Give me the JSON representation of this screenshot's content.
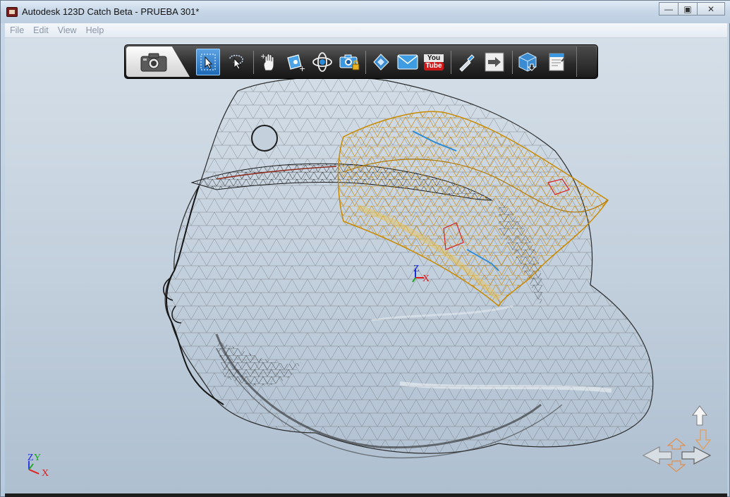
{
  "window": {
    "title": "Autodesk 123D Catch Beta - PRUEBA 301*",
    "minimize_glyph": "—",
    "restore_glyph": "▣",
    "close_glyph": "✕"
  },
  "menu": {
    "items": [
      "File",
      "Edit",
      "View",
      "Help"
    ]
  },
  "toolbar": {
    "youtube_top": "You",
    "youtube_bottom": "Tube",
    "tools": [
      "select-icon",
      "lasso-select-icon",
      "pan-hand-icon",
      "add-point-icon",
      "orbit-icon",
      "locked-camera-icon",
      "film-icon",
      "email-icon",
      "youtube-icon",
      "eyedropper-icon",
      "export-icon",
      "mesh-download-icon",
      "settings-document-icon"
    ]
  },
  "axes": {
    "z": "Z",
    "y": "Y",
    "x": "X"
  },
  "colors": {
    "axis_x": "#e01b1b",
    "axis_y": "#19a619",
    "axis_z": "#1b2de0",
    "selection_mesh": "#f0b21c",
    "active_tool": "#2a78c6"
  }
}
